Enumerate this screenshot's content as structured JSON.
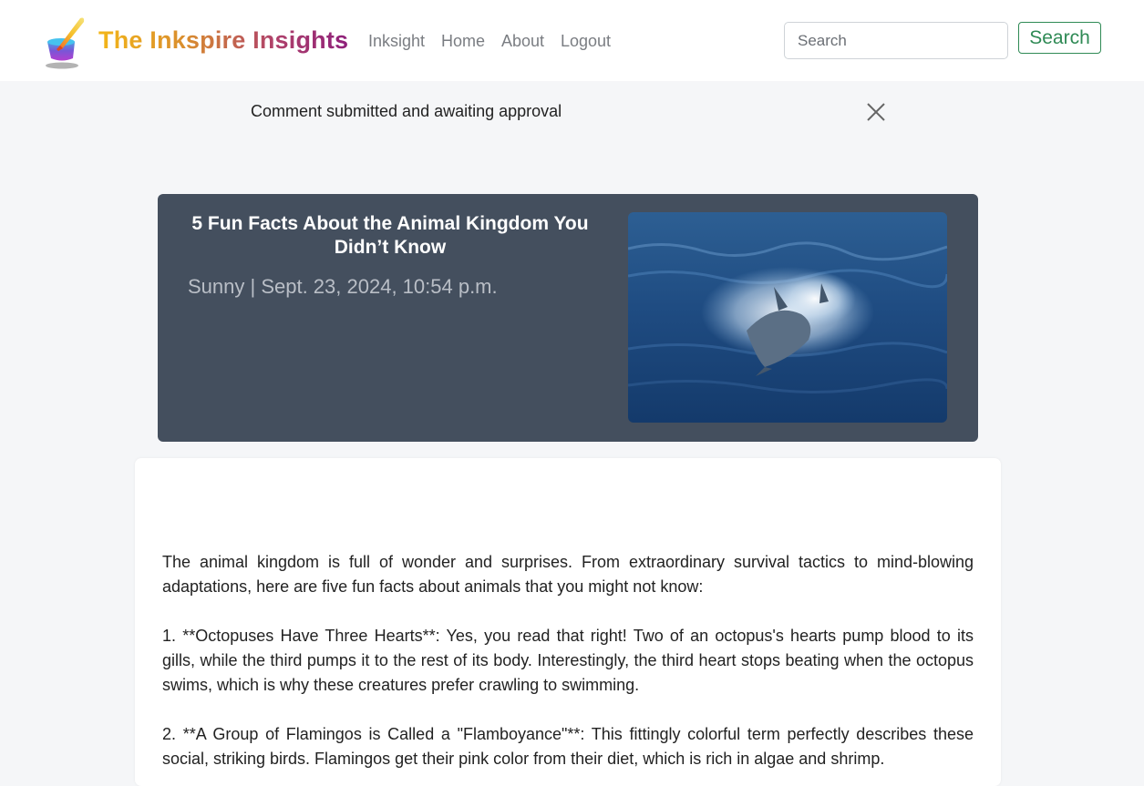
{
  "brand": {
    "name": "The Inkspire Insights"
  },
  "nav": {
    "links": [
      "Inksight",
      "Home",
      "About",
      "Logout"
    ]
  },
  "search": {
    "placeholder": "Search",
    "button_label": "Search"
  },
  "alert": {
    "message": "Comment submitted and awaiting approval"
  },
  "post": {
    "title": "5 Fun Facts About the Animal Kingdom You Didn’t Know",
    "meta": "Sunny | Sept. 23, 2024, 10:54 p.m.",
    "paragraphs": [
      "The animal kingdom is full of wonder and surprises. From extraordinary survival tactics to mind-blowing adaptations, here are five fun facts about animals that you might not know:",
      "1. **Octopuses Have Three Hearts**: Yes, you read that right! Two of an octopus's hearts pump blood to its gills, while the third pumps it to the rest of its body. Interestingly, the third heart stops beating when the octopus swims, which is why these creatures prefer crawling to swimming.",
      "2. **A Group of Flamingos is Called a \"Flamboyance\"**: This fittingly colorful term perfectly describes these social, striking birds. Flamingos get their pink color from their diet, which is rich in algae and shrimp."
    ]
  },
  "icons": {
    "logo": "ink-pot-quill-logo",
    "close": "close-icon",
    "hero_image": "dolphin-ocean-image"
  },
  "colors": {
    "hero_bg": "#444f5e",
    "search_green": "#2f8a55",
    "page_bg": "#f5f6f8"
  }
}
